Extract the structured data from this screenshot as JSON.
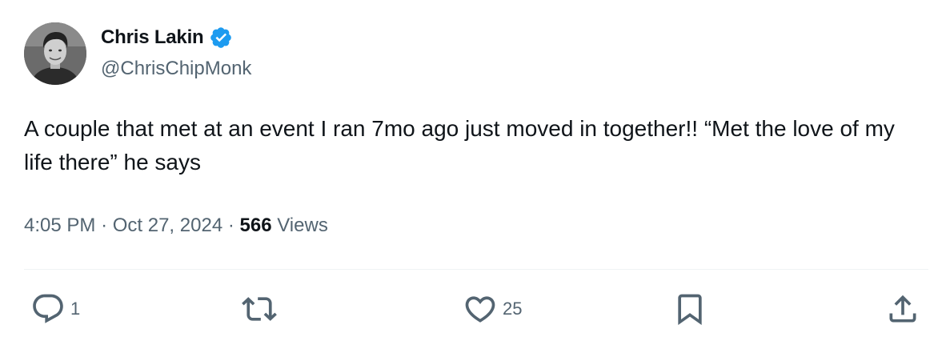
{
  "author": {
    "display_name": "Chris Lakin",
    "handle": "@ChrisChipMonk",
    "verified": true
  },
  "tweet": {
    "text": "A couple that met at an event I ran 7mo ago just moved in together!! “Met the love of my life there” he says",
    "time": "4:05 PM",
    "separator": "·",
    "date": "Oct 27, 2024",
    "views_count": "566",
    "views_label": "Views"
  },
  "actions": {
    "reply_count": "1",
    "like_count": "25"
  },
  "colors": {
    "text_primary": "#0f1419",
    "text_secondary": "#536471",
    "verified_blue": "#1d9bf0",
    "divider": "#eff3f4"
  },
  "icons": [
    "reply-icon",
    "retweet-icon",
    "like-icon",
    "bookmark-icon",
    "share-icon",
    "verified-badge-icon"
  ]
}
